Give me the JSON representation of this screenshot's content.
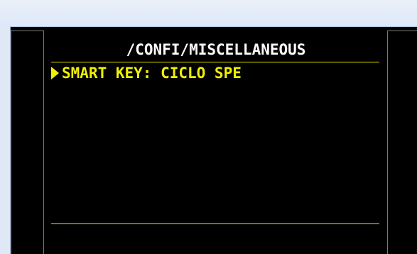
{
  "screen": {
    "title": "/CONFI/MISCELLANEOUS",
    "menu": [
      {
        "label": "SMART KEY: CICLO SPE",
        "selected": true,
        "cursor_icon": "triangle-right-icon"
      }
    ]
  },
  "colors": {
    "background": "#000000",
    "title_text": "#ffffff",
    "highlight": "#f0f000",
    "rule": "#e8e800"
  }
}
